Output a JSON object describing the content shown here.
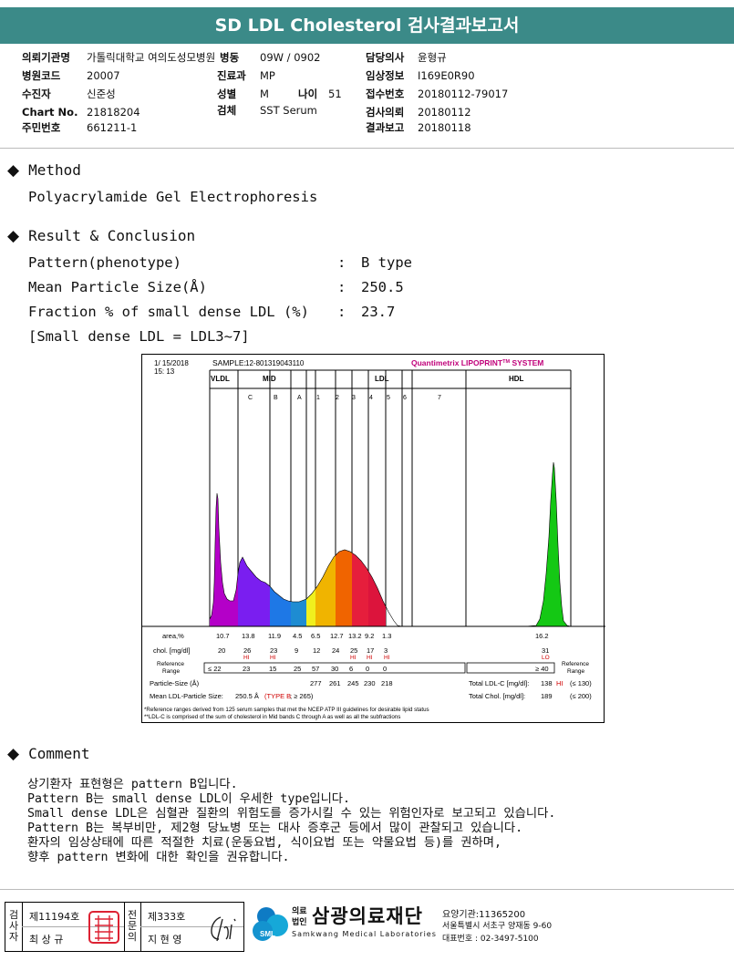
{
  "title": "SD LDL Cholesterol 검사결과보고서",
  "header": {
    "inst_label": "의뢰기관명",
    "inst_value": "가톨릭대학교 여의도성모병원",
    "ward_label": "병동",
    "ward_value": "09W / 0902",
    "doctor_label": "담당의사",
    "doctor_value": "윤형규",
    "code_label": "병원코드",
    "code_value": "20007",
    "dept_label": "진료과",
    "dept_value": "MP",
    "clinical_label": "임상정보",
    "clinical_value": "I169E0R90",
    "patient_label": "수진자",
    "patient_value": "신준성",
    "sex_label": "성별",
    "sex_value": "M",
    "age_label": "나이",
    "age_value": "51",
    "receipt_label": "접수번호",
    "receipt_value": "20180112-79017",
    "chart_label": "Chart No.",
    "chart_value": "21818204",
    "specimen_label": "검체",
    "specimen_value": "SST Serum",
    "request_label": "검사의뢰",
    "request_value": "20180112",
    "id_label": "주민번호",
    "id_value": "661211-1",
    "report_label": "결과보고",
    "report_value": "20180118"
  },
  "method": {
    "heading": "Method",
    "text": "Polyacrylamide Gel Electrophoresis"
  },
  "result": {
    "heading": "Result & Conclusion",
    "rows": [
      {
        "label": "Pattern(phenotype)",
        "value": "B type"
      },
      {
        "label": "Mean Particle Size(Å)",
        "value": "250.5"
      },
      {
        "label": "Fraction % of small dense LDL (%)",
        "value": "23.7"
      }
    ],
    "note": "[Small dense LDL = LDL3~7]"
  },
  "report": {
    "date": "1/ 15/2018",
    "time": "15: 13",
    "sample_label": "SAMPLE:",
    "sample_value": "12-801319043110",
    "brand": "Quantimetrix LIPOPRINT",
    "brand_tm": "TM",
    "brand_suffix": " SYSTEM",
    "bands": {
      "vldl": "VLDL",
      "mid": "MID",
      "ldl": "LDL",
      "hdl": "HDL",
      "sub": [
        "C",
        "B",
        "A",
        "1",
        "2",
        "3",
        "4",
        "5",
        "6",
        "7"
      ]
    },
    "area_label": "area,%",
    "area": [
      "10.7",
      "13.8",
      "11.9",
      "4.5",
      "6.5",
      "12.7",
      "13.2",
      "9.2",
      "1.3"
    ],
    "area_hdl": "16.2",
    "chol_label": "chol. [mg/dl]",
    "chol": [
      "20",
      "26",
      "23",
      "9",
      "12",
      "24",
      "25",
      "17",
      "3"
    ],
    "chol_hdl": "31",
    "flags": [
      "",
      "HI",
      "HI",
      "",
      "",
      "",
      "HI",
      "HI",
      "HI"
    ],
    "hdl_flag": "LO",
    "ref_label": "Reference Range",
    "ref_label2": "Reference Range",
    "ref": [
      "≤ 22",
      "23",
      "15",
      "25",
      "57",
      "30",
      "6",
      "0",
      "0"
    ],
    "ref_hdl": "≥ 40",
    "particle_label": "Particle-Size (Å)",
    "particle": [
      "277",
      "261",
      "245",
      "230",
      "218"
    ],
    "mean_label": "Mean LDL-Particle Size:",
    "mean_value": "250.5 Å",
    "mean_type": "(TYPE B",
    "mean_ref": "; ≥ 265)",
    "total_ldl_label": "Total LDL-C [mg/dl]:",
    "total_ldl_value": "138",
    "total_ldl_flag": "HI",
    "total_ldl_ref": "(≤ 130)",
    "total_chol_label": "Total Chol. [mg/dl]:",
    "total_chol_value": "189",
    "total_chol_ref": "(≤ 200)",
    "footnote1": "*Reference ranges derived from 125 serum samples that met the NCEP ATP III guidelines for desirable lipid status",
    "footnote2": "**LDL-C is comprised of the sum of cholesterol in Mid bands C through A as well as all the subfractions",
    "colors": [
      "#b400c8",
      "#7a1ef0",
      "#1e78e6",
      "#1e8cd2",
      "#f0f01e",
      "#f0b400",
      "#f06400",
      "#e61e3c",
      "#dc143c",
      "#14c814"
    ]
  },
  "comment": {
    "heading": "Comment",
    "lines": [
      "상기환자 표현형은 pattern B입니다.",
      "Pattern B는 small dense LDL이 우세한 type입니다.",
      "Small dense LDL은 심혈관 질환의 위험도를 증가시킬 수 있는 위험인자로 보고되고 있습니다.",
      "Pattern B는 복부비만, 제2형 당뇨병 또는 대사 증후군 등에서 많이 관찰되고 있습니다.",
      "환자의 임상상태에 따른 적절한 치료(운동요법, 식이요법 또는 약물요법 등)를 권하며,",
      "향후 pattern 변화에 대한 확인을 권유합니다."
    ]
  },
  "footer": {
    "tester_label": "검사자",
    "tester_no": "제11194호",
    "tester_name": "최 상 규",
    "expert_label": "전문의",
    "expert_no": "제333호",
    "expert_name": "지 현 영",
    "org_small1": "의료",
    "org_small2": "법인",
    "org_name": "삼광의료재단",
    "org_eng": "Samkwang Medical Laboratories",
    "logo_text": "SML",
    "code": "요양기관:11365200",
    "address": "서울특별시 서초구 양재동 9-60",
    "phone": "대표번호 : 02-3497-5100"
  }
}
